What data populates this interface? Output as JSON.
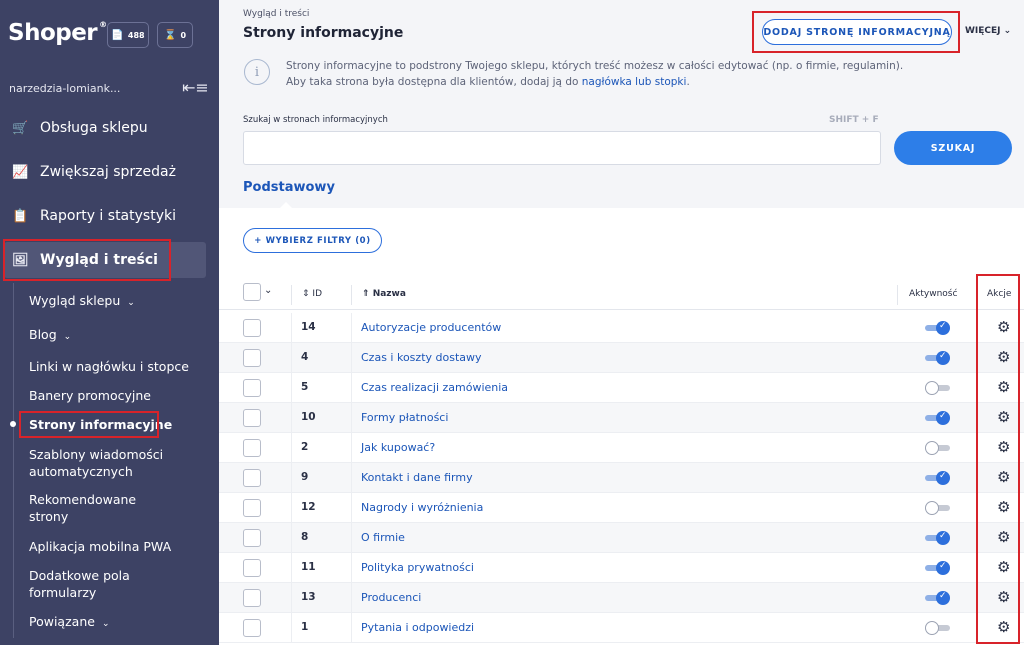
{
  "sidebar": {
    "logo": "Shoper",
    "logo_mark": "®",
    "badges": [
      {
        "icon": "document-icon",
        "count": "488"
      },
      {
        "icon": "hourglass-icon",
        "count": "0"
      }
    ],
    "shop_name": "narzedzia-lomiank...",
    "nav": [
      {
        "label": "Obsługa sklepu",
        "icon": "cart-icon"
      },
      {
        "label": "Zwiększaj sprzedaż",
        "icon": "chart-icon"
      },
      {
        "label": "Raporty i statystyki",
        "icon": "clipboard-icon"
      },
      {
        "label": "Wygląd i treści",
        "icon": "image-icon"
      }
    ],
    "sub": [
      {
        "label": "Wygląd sklepu"
      },
      {
        "label": "Blog"
      },
      {
        "label": "Linki w nagłówku i stopce"
      },
      {
        "label": "Banery promocyjne"
      },
      {
        "label": "Strony informacyjne"
      },
      {
        "label": "Szablony wiadomości automatycznych"
      },
      {
        "label": "Rekomendowane strony"
      },
      {
        "label": "Aplikacja mobilna PWA"
      },
      {
        "label": "Dodatkowe pola formularzy"
      },
      {
        "label": "Powiązane"
      }
    ]
  },
  "header": {
    "breadcrumb": "Wygląd i treści",
    "title": "Strony informacyjne",
    "add_button": "DODAJ STRONĘ INFORMACYJNĄ",
    "more_button": "WIĘCEJ"
  },
  "info": {
    "line1": "Strony informacyjne to podstrony Twojego sklepu, których treść możesz w całości edytować (np. o firmie, regulamin).",
    "line2_pre": "Aby taka strona była dostępna dla klientów, dodaj ją do ",
    "line2_link": "nagłówka lub stopki",
    "line2_post": "."
  },
  "search": {
    "label": "Szukaj w stronach informacyjnych",
    "shortcut": "SHIFT + F",
    "placeholder": "",
    "value": "",
    "button": "SZUKAJ"
  },
  "tabs": [
    {
      "label": "Podstawowy"
    }
  ],
  "filters": {
    "button": "+ WYBIERZ FILTRY (0)"
  },
  "table": {
    "columns": {
      "id": "ID",
      "name": "Nazwa",
      "active": "Aktywność",
      "actions": "Akcje"
    },
    "rows": [
      {
        "id": "14",
        "name": "Autoryzacje producentów",
        "active": true
      },
      {
        "id": "4",
        "name": "Czas i koszty dostawy",
        "active": true
      },
      {
        "id": "5",
        "name": "Czas realizacji zamówienia",
        "active": false
      },
      {
        "id": "10",
        "name": "Formy płatności",
        "active": true
      },
      {
        "id": "2",
        "name": "Jak kupować?",
        "active": false
      },
      {
        "id": "9",
        "name": "Kontakt i dane firmy",
        "active": true
      },
      {
        "id": "12",
        "name": "Nagrody i wyróżnienia",
        "active": false
      },
      {
        "id": "8",
        "name": "O firmie",
        "active": true
      },
      {
        "id": "11",
        "name": "Polityka prywatności",
        "active": true
      },
      {
        "id": "13",
        "name": "Producenci",
        "active": true
      },
      {
        "id": "1",
        "name": "Pytania i odpowiedzi",
        "active": false
      }
    ]
  },
  "colors": {
    "accent": "#2d6fdc",
    "sidebar": "#3d4264",
    "highlight": "#d8232a"
  }
}
